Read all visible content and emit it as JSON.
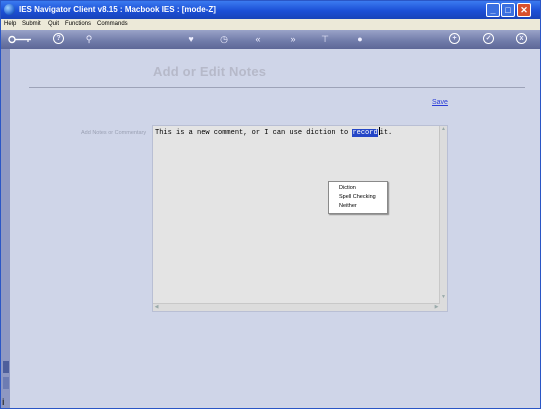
{
  "window": {
    "title": "IES Navigator Client v8.15 : Macbook IES :      [mode-Z]",
    "icons": [
      "app-globe-icon",
      "minimize-icon",
      "maximize-icon",
      "close-icon"
    ]
  },
  "menu": {
    "items": [
      "Help",
      "Submit",
      "Quit",
      "Functions",
      "Commands"
    ]
  },
  "toolbar": {
    "icons": [
      "key-icon",
      "help-icon",
      "search-icon",
      "heart-icon",
      "clock-icon",
      "back-icon",
      "forward-icon",
      "filter-icon",
      "record-icon",
      "add-icon",
      "check-icon",
      "cancel-icon"
    ],
    "help_glyph": "?",
    "search_glyph": "⚲",
    "heart_glyph": "♥",
    "clock_glyph": "◷",
    "back_glyph": "«",
    "forward_glyph": "»",
    "filter_glyph": "⊤",
    "record_glyph": "●",
    "add_glyph": "+",
    "check_glyph": "✓",
    "cancel_glyph": "x"
  },
  "page": {
    "title": "Add or Edit Notes",
    "save_label": "Save",
    "field_label": "Add Notes or Commentary"
  },
  "editor": {
    "text_before": "This is a new comment, or I can use diction to ",
    "selected_word": "record",
    "text_after": "it."
  },
  "context_menu": {
    "items": [
      "Diction",
      "Spell Checking",
      "Neither"
    ]
  },
  "colors": {
    "titlebar": "#1b4fd6",
    "content_bg": "#cfd5e8",
    "selection": "#2446c7",
    "link": "#2c3ed8"
  }
}
